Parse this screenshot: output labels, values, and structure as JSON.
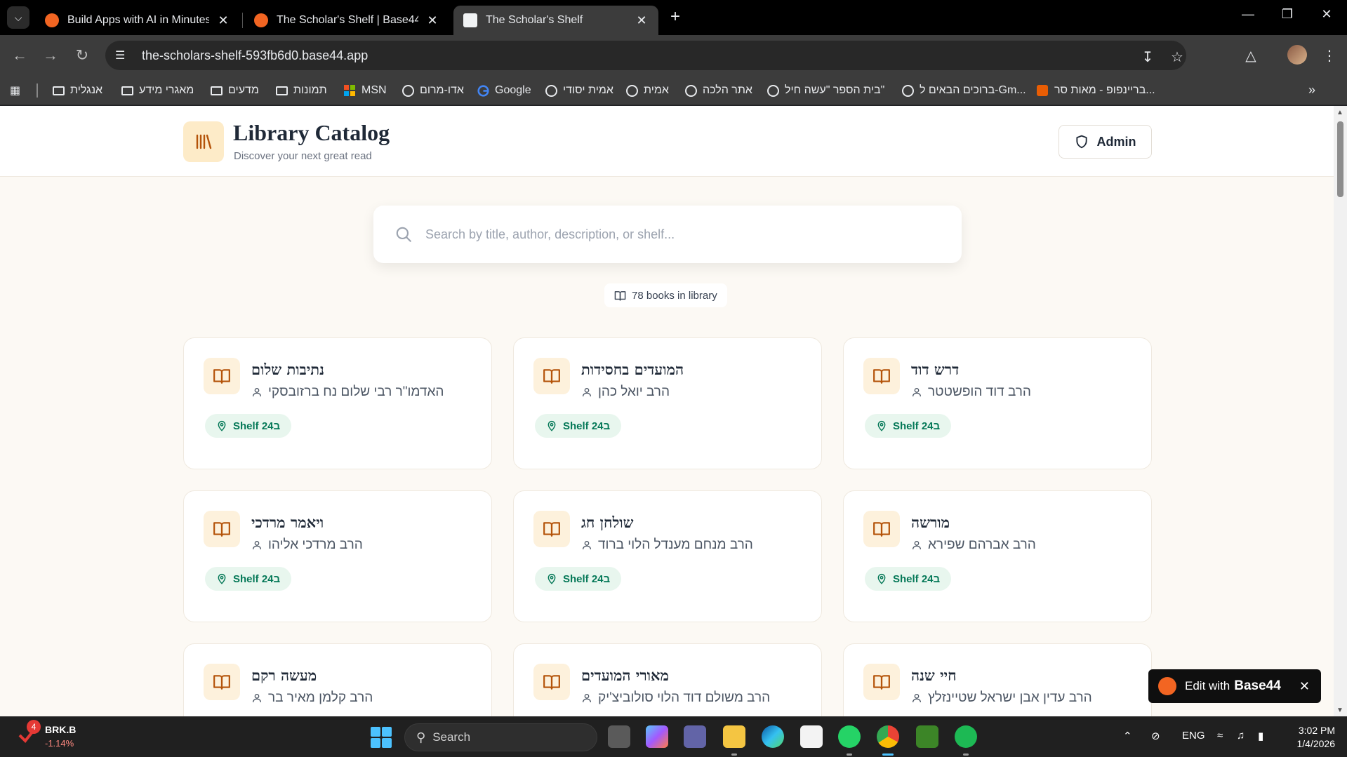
{
  "browser": {
    "tabs": [
      {
        "title": "Build Apps with AI in Minutes | B",
        "favicon": "base44-icon",
        "active": false
      },
      {
        "title": "The Scholar's Shelf | Base44",
        "favicon": "base44-icon",
        "active": false
      },
      {
        "title": "The Scholar's Shelf",
        "favicon": "doc-icon",
        "active": true
      }
    ],
    "url": "the-scholars-shelf-593fb6d0.base44.app",
    "bookmarks": [
      {
        "label": "אנגלית",
        "icon": "folder-icon"
      },
      {
        "label": "מאגרי מידע",
        "icon": "folder-icon"
      },
      {
        "label": "מדעים",
        "icon": "folder-icon"
      },
      {
        "label": "תמונות",
        "icon": "folder-icon"
      },
      {
        "label": "MSN",
        "icon": "msn-icon"
      },
      {
        "label": "אדו-מרום",
        "icon": "globe-icon"
      },
      {
        "label": "Google",
        "icon": "google-icon"
      },
      {
        "label": "אמית יסודי",
        "icon": "globe-icon"
      },
      {
        "label": "אמית",
        "icon": "globe-icon"
      },
      {
        "label": "אתר הלכה",
        "icon": "globe-icon"
      },
      {
        "label": "בית הספר \"עשה חיל\"",
        "icon": "globe-icon"
      },
      {
        "label": "ברוכים הבאים ל-Gm...",
        "icon": "globe-icon"
      },
      {
        "label": "בריינפופ - מאות סר...",
        "icon": "brainpop-icon"
      }
    ]
  },
  "header": {
    "title": "Library Catalog",
    "subtitle": "Discover your next great read",
    "admin_label": "Admin"
  },
  "search": {
    "placeholder": "Search by title, author, description, or shelf..."
  },
  "library": {
    "count_text": "78 books in library"
  },
  "books": [
    {
      "title": "נתיבות שלום",
      "author": "האדמו\"ר רבי שלום נח ברזובסקי",
      "shelf": "Shelf 24ב"
    },
    {
      "title": "המועדים בחסידות",
      "author": "הרב יואל כהן",
      "shelf": "Shelf 24ב"
    },
    {
      "title": "דרש דוד",
      "author": "הרב דוד הופשטטר",
      "shelf": "Shelf 24ב"
    },
    {
      "title": "ויאמר מרדכי",
      "author": "הרב מרדכי אליהו",
      "shelf": "Shelf 24ב"
    },
    {
      "title": "שולחן חג",
      "author": "הרב מנחם מענדל הלוי ברוד",
      "shelf": "Shelf 24ב"
    },
    {
      "title": "מורשה",
      "author": "הרב אברהם שפירא",
      "shelf": "Shelf 24ב"
    },
    {
      "title": "מעשה רקם",
      "author": "הרב קלמן מאיר בר",
      "shelf": ""
    },
    {
      "title": "מאורי המועדים",
      "author": "הרב משולם דוד הלוי סולוביצ'יק",
      "shelf": ""
    },
    {
      "title": "חיי שנה",
      "author": "הרב עדין אבן ישראל שטיינזלץ",
      "shelf": ""
    }
  ],
  "edit_badge": {
    "text": "Edit with",
    "brand": "Base44"
  },
  "taskbar": {
    "stock_symbol": "BRK.B",
    "stock_change": "-1.14%",
    "stock_badge": "4",
    "search_label": "Search",
    "language": "ENG",
    "time": "3:02 PM",
    "date": "1/4/2026"
  },
  "colors": {
    "accent": "#b45309",
    "logo_bg": "#fdebc8",
    "shelf_green": "#047857",
    "shelf_bg": "#e8f6ee",
    "page_bg": "#fcf9f4"
  }
}
